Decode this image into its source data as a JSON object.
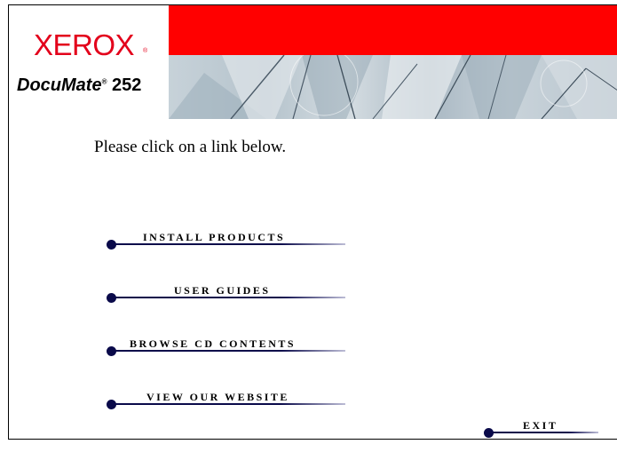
{
  "brand": {
    "logo_text": "XEROX",
    "logo_mark": "®",
    "product_name": "DocuMate",
    "product_mark": "®",
    "product_model": "252"
  },
  "colors": {
    "banner_red": "#ff0000",
    "logo_red": "#e3001b",
    "link_navy": "#0a0a4a"
  },
  "instruction": "Please click on a link below.",
  "menu": {
    "install": "INSTALL PRODUCTS",
    "guides": "USER GUIDES",
    "browse": "BROWSE CD CONTENTS",
    "website": "VIEW OUR WEBSITE",
    "exit": "EXIT"
  }
}
